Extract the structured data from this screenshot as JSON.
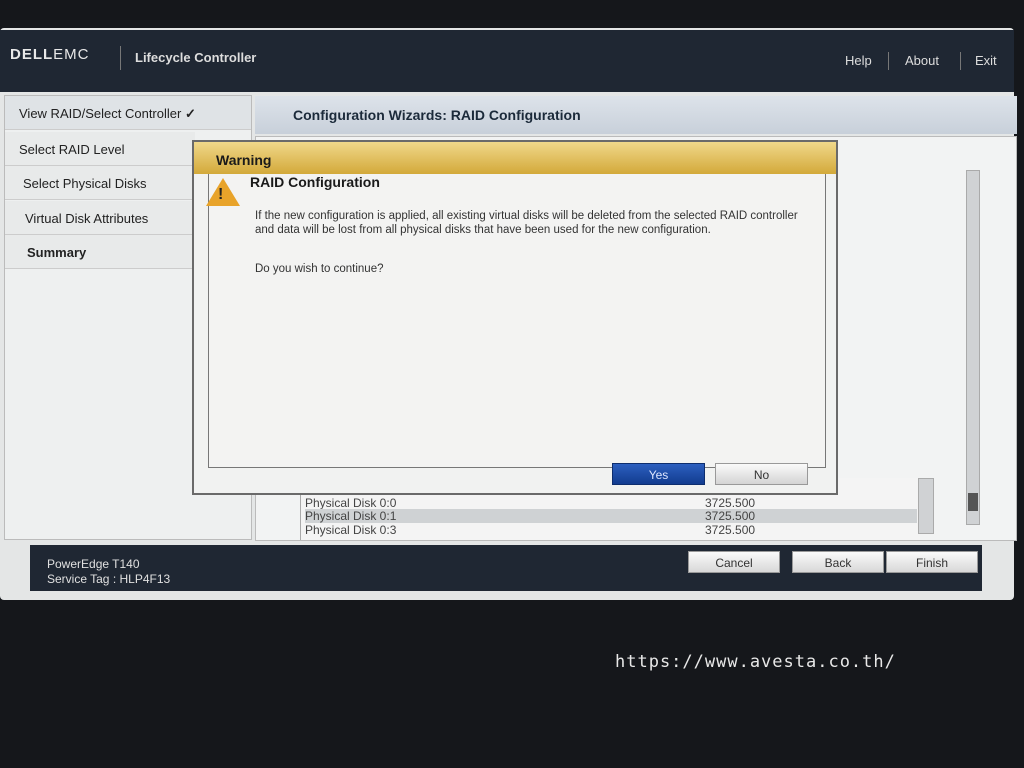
{
  "header": {
    "brand": "DELL",
    "brand2": "EMC",
    "app": "Lifecycle Controller",
    "links": [
      "Help",
      "About",
      "Exit"
    ]
  },
  "nav": {
    "items": [
      {
        "label": "View RAID/Select Controller",
        "done": true
      },
      {
        "label": "Select RAID Level"
      },
      {
        "label": "Select Physical Disks"
      },
      {
        "label": "Virtual Disk Attributes"
      },
      {
        "label": "Summary",
        "active": true
      }
    ],
    "check": "✓"
  },
  "main": {
    "title": "Configuration Wizards: RAID Configuration",
    "disks": [
      {
        "name": "Physical Disk 0:0",
        "size": "3725.500"
      },
      {
        "name": "Physical Disk 0:1",
        "size": "3725.500",
        "selected": true
      },
      {
        "name": "Physical Disk 0:3",
        "size": "3725.500"
      }
    ]
  },
  "footer": {
    "model": "PowerEdge T140",
    "service_tag": "Service Tag : HLP4F13",
    "cancel": "Cancel",
    "back": "Back",
    "finish": "Finish"
  },
  "dialog": {
    "header": "Warning",
    "title": "RAID Configuration",
    "message": "If the new configuration is applied, all existing virtual disks will be deleted from the selected RAID controller and data will be lost from all physical disks that have been used for the new configuration.",
    "question": "Do you wish to continue?",
    "yes": "Yes",
    "no": "No",
    "icon": "warning-triangle-icon"
  },
  "watermark": "https://www.avesta.co.th/",
  "colors": {
    "header": "#1f2733",
    "warning": "#d3a93a",
    "primary": "#123c8f"
  }
}
